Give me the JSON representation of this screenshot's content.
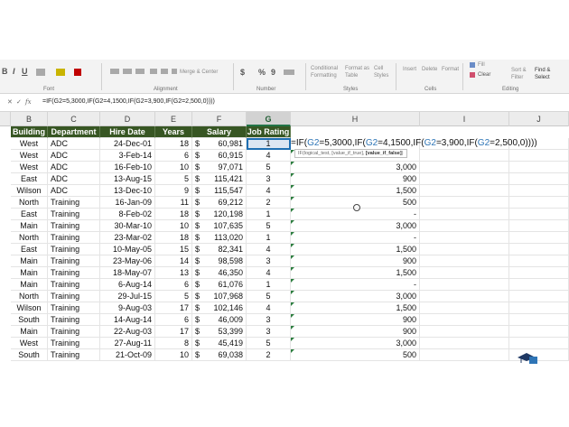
{
  "ribbon": {
    "groups": {
      "font": "Font",
      "alignment": "Alignment",
      "number": "Number",
      "styles": "Styles",
      "cells": "Cells",
      "editing": "Editing"
    },
    "merge_center": "Merge & Center",
    "conditional_formatting": "Conditional Formatting",
    "format_as_table": "Format as Table",
    "cell_styles": "Cell Styles",
    "insert": "Insert",
    "delete": "Delete",
    "format": "Format",
    "fill": "Fill",
    "clear": "Clear",
    "sort_filter": "Sort & Filter",
    "find_select": "Find & Select",
    "currency": "$",
    "percent": "%",
    "comma": "9"
  },
  "formula_bar": {
    "cancel": "✕",
    "enter": "✓",
    "fx": "fx",
    "text": "=IF(G2=5,3000,IF(G2=4,1500,IF(G2=3,900,IF(G2=2,500,0))))"
  },
  "columns": [
    "B",
    "C",
    "D",
    "E",
    "F",
    "G",
    "H",
    "I",
    "J"
  ],
  "headers": [
    "Building",
    "Department",
    "Hire Date",
    "Years",
    "Salary",
    "Job Rating"
  ],
  "rows": [
    {
      "building": "West",
      "dept": "ADC",
      "date": "24-Dec-01",
      "years": "18",
      "cur": "$",
      "salary": "60,981",
      "rating": "1",
      "h": ""
    },
    {
      "building": "West",
      "dept": "ADC",
      "date": "3-Feb-14",
      "years": "6",
      "cur": "$",
      "salary": "60,915",
      "rating": "4",
      "h": ""
    },
    {
      "building": "West",
      "dept": "ADC",
      "date": "16-Feb-10",
      "years": "10",
      "cur": "$",
      "salary": "97,071",
      "rating": "5",
      "h": "3,000"
    },
    {
      "building": "East",
      "dept": "ADC",
      "date": "13-Aug-15",
      "years": "5",
      "cur": "$",
      "salary": "115,421",
      "rating": "3",
      "h": "900"
    },
    {
      "building": "Wilson",
      "dept": "ADC",
      "date": "13-Dec-10",
      "years": "9",
      "cur": "$",
      "salary": "115,547",
      "rating": "4",
      "h": "1,500"
    },
    {
      "building": "North",
      "dept": "Training",
      "date": "16-Jan-09",
      "years": "11",
      "cur": "$",
      "salary": "69,212",
      "rating": "2",
      "h": "500"
    },
    {
      "building": "East",
      "dept": "Training",
      "date": "8-Feb-02",
      "years": "18",
      "cur": "$",
      "salary": "120,198",
      "rating": "1",
      "h": "-"
    },
    {
      "building": "Main",
      "dept": "Training",
      "date": "30-Mar-10",
      "years": "10",
      "cur": "$",
      "salary": "107,635",
      "rating": "5",
      "h": "3,000"
    },
    {
      "building": "North",
      "dept": "Training",
      "date": "23-Mar-02",
      "years": "18",
      "cur": "$",
      "salary": "113,020",
      "rating": "1",
      "h": "-"
    },
    {
      "building": "East",
      "dept": "Training",
      "date": "10-May-05",
      "years": "15",
      "cur": "$",
      "salary": "82,341",
      "rating": "4",
      "h": "1,500"
    },
    {
      "building": "Main",
      "dept": "Training",
      "date": "23-May-06",
      "years": "14",
      "cur": "$",
      "salary": "98,598",
      "rating": "3",
      "h": "900"
    },
    {
      "building": "Main",
      "dept": "Training",
      "date": "18-May-07",
      "years": "13",
      "cur": "$",
      "salary": "46,350",
      "rating": "4",
      "h": "1,500"
    },
    {
      "building": "Main",
      "dept": "Training",
      "date": "6-Aug-14",
      "years": "6",
      "cur": "$",
      "salary": "61,076",
      "rating": "1",
      "h": "-"
    },
    {
      "building": "North",
      "dept": "Training",
      "date": "29-Jul-15",
      "years": "5",
      "cur": "$",
      "salary": "107,968",
      "rating": "5",
      "h": "3,000"
    },
    {
      "building": "Wilson",
      "dept": "Training",
      "date": "9-Aug-03",
      "years": "17",
      "cur": "$",
      "salary": "102,146",
      "rating": "4",
      "h": "1,500"
    },
    {
      "building": "South",
      "dept": "Training",
      "date": "14-Aug-14",
      "years": "6",
      "cur": "$",
      "salary": "46,009",
      "rating": "3",
      "h": "900"
    },
    {
      "building": "Main",
      "dept": "Training",
      "date": "22-Aug-03",
      "years": "17",
      "cur": "$",
      "salary": "53,399",
      "rating": "3",
      "h": "900"
    },
    {
      "building": "West",
      "dept": "Training",
      "date": "27-Aug-11",
      "years": "8",
      "cur": "$",
      "salary": "45,419",
      "rating": "5",
      "h": "3,000"
    },
    {
      "building": "South",
      "dept": "Training",
      "date": "21-Oct-09",
      "years": "10",
      "cur": "$",
      "salary": "69,038",
      "rating": "2",
      "h": "500"
    }
  ],
  "edit": {
    "prefix": "=IF(",
    "ref": "G2",
    "seg1": "=5,3000,IF(",
    "seg2": "=4,1500,IF(",
    "seg3": "=3,900,IF(",
    "seg4": "=2,500,0))))"
  },
  "tooltip": {
    "text": "IF(logical_test, [value_if_true], ",
    "bold": "[value_if_false]",
    "close": ")"
  }
}
